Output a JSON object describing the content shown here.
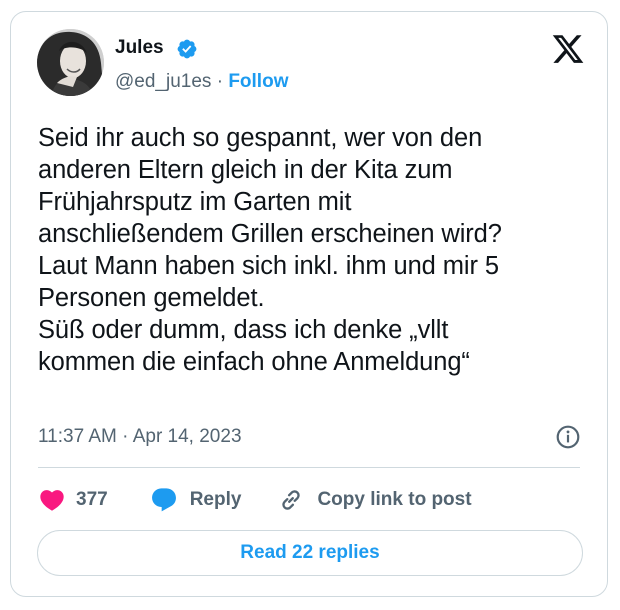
{
  "author": {
    "name": "Jules",
    "handle": "@ed_ju1es",
    "separator": "·",
    "follow_label": "Follow",
    "avatar_icon": "profile-photo-avatar",
    "verified_icon": "verified-badge-icon"
  },
  "tweet": {
    "text": "Seid ihr auch so gespannt, wer von den\nanderen Eltern gleich in der Kita zum\nFrühjahrsputz im Garten mit\nanschließendem Grillen erscheinen wird?\nLaut Mann haben sich inkl. ihm und mir 5\nPersonen gemeldet.\nSüß oder dumm, dass ich denke „vllt\nkommen die einfach ohne Anmeldung“",
    "timestamp": "11:37 AM · Apr 14, 2023"
  },
  "actions": {
    "like_count": "377",
    "reply_label": "Reply",
    "copy_label": "Copy link to post"
  },
  "read_replies_label": "Read 22 replies",
  "colors": {
    "accent": "#1d9bf0",
    "like": "#f91880",
    "text": "#0f1419",
    "muted": "#536471"
  }
}
